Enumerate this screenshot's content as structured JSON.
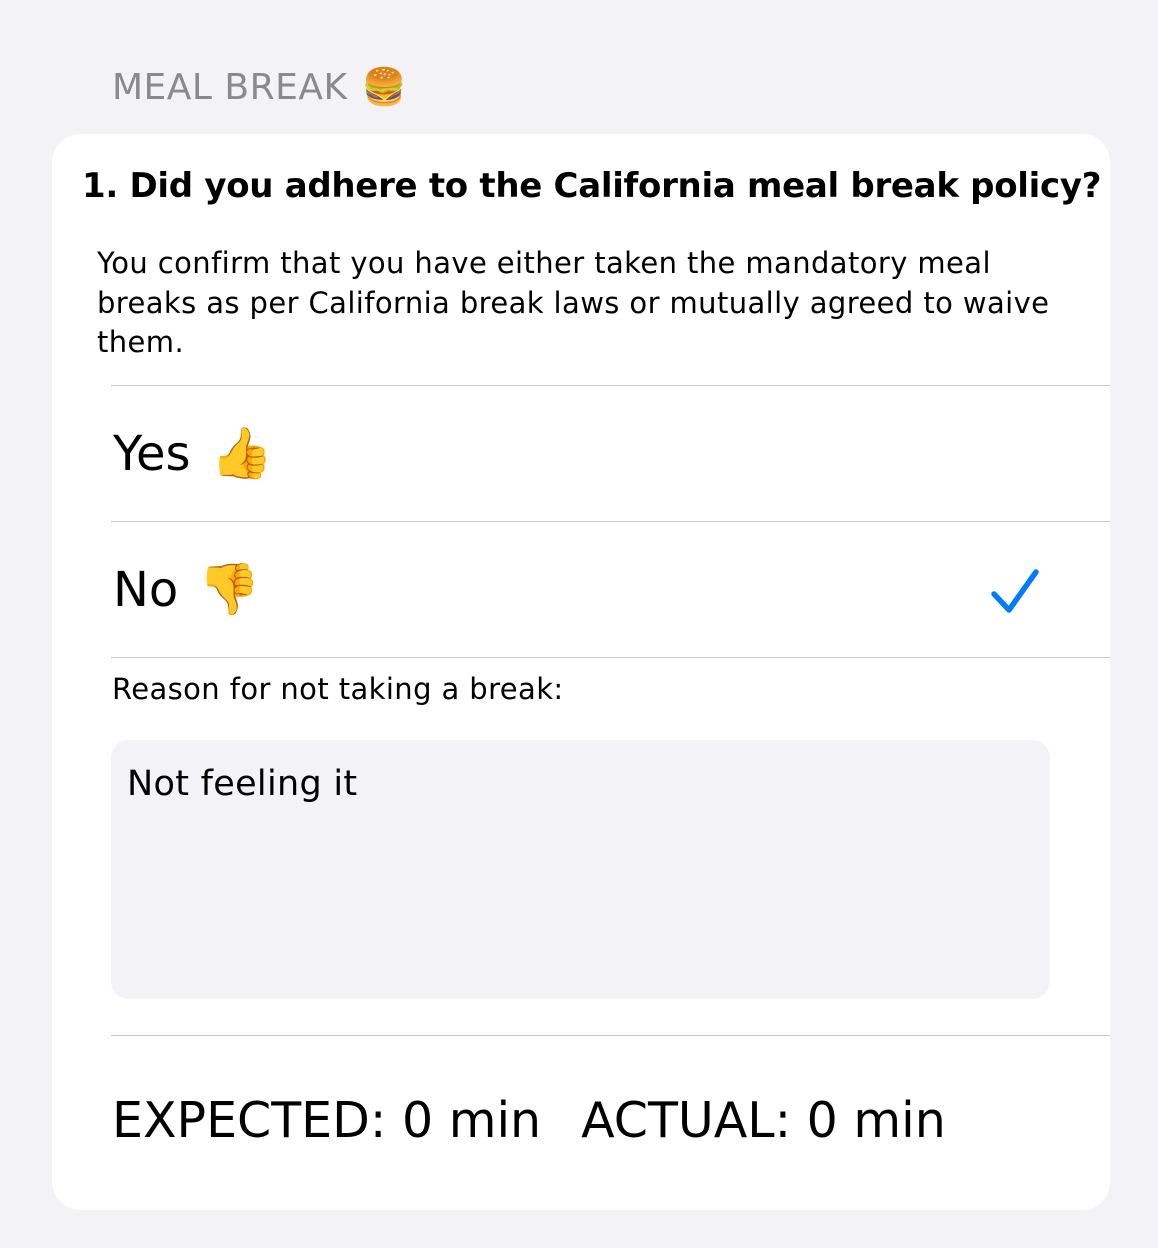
{
  "section": {
    "title": "MEAL BREAK",
    "emoji": "🍔"
  },
  "question": {
    "title": "1. Did you adhere to the California meal break policy?",
    "description": "You confirm that you have either taken the mandatory meal breaks as per California break laws or mutually agreed to waive them."
  },
  "options": [
    {
      "label": "Yes",
      "emoji": "👍",
      "selected": false
    },
    {
      "label": "No",
      "emoji": "👎",
      "selected": true
    }
  ],
  "reason": {
    "label": "Reason for not taking a break:",
    "value": "Not feeling it"
  },
  "durations": {
    "expected": "EXPECTED: 0 min",
    "actual": "ACTUAL: 0 min"
  },
  "colors": {
    "accent": "#007aff",
    "background": "#f2f2f7",
    "header": "#8a8a8e"
  }
}
